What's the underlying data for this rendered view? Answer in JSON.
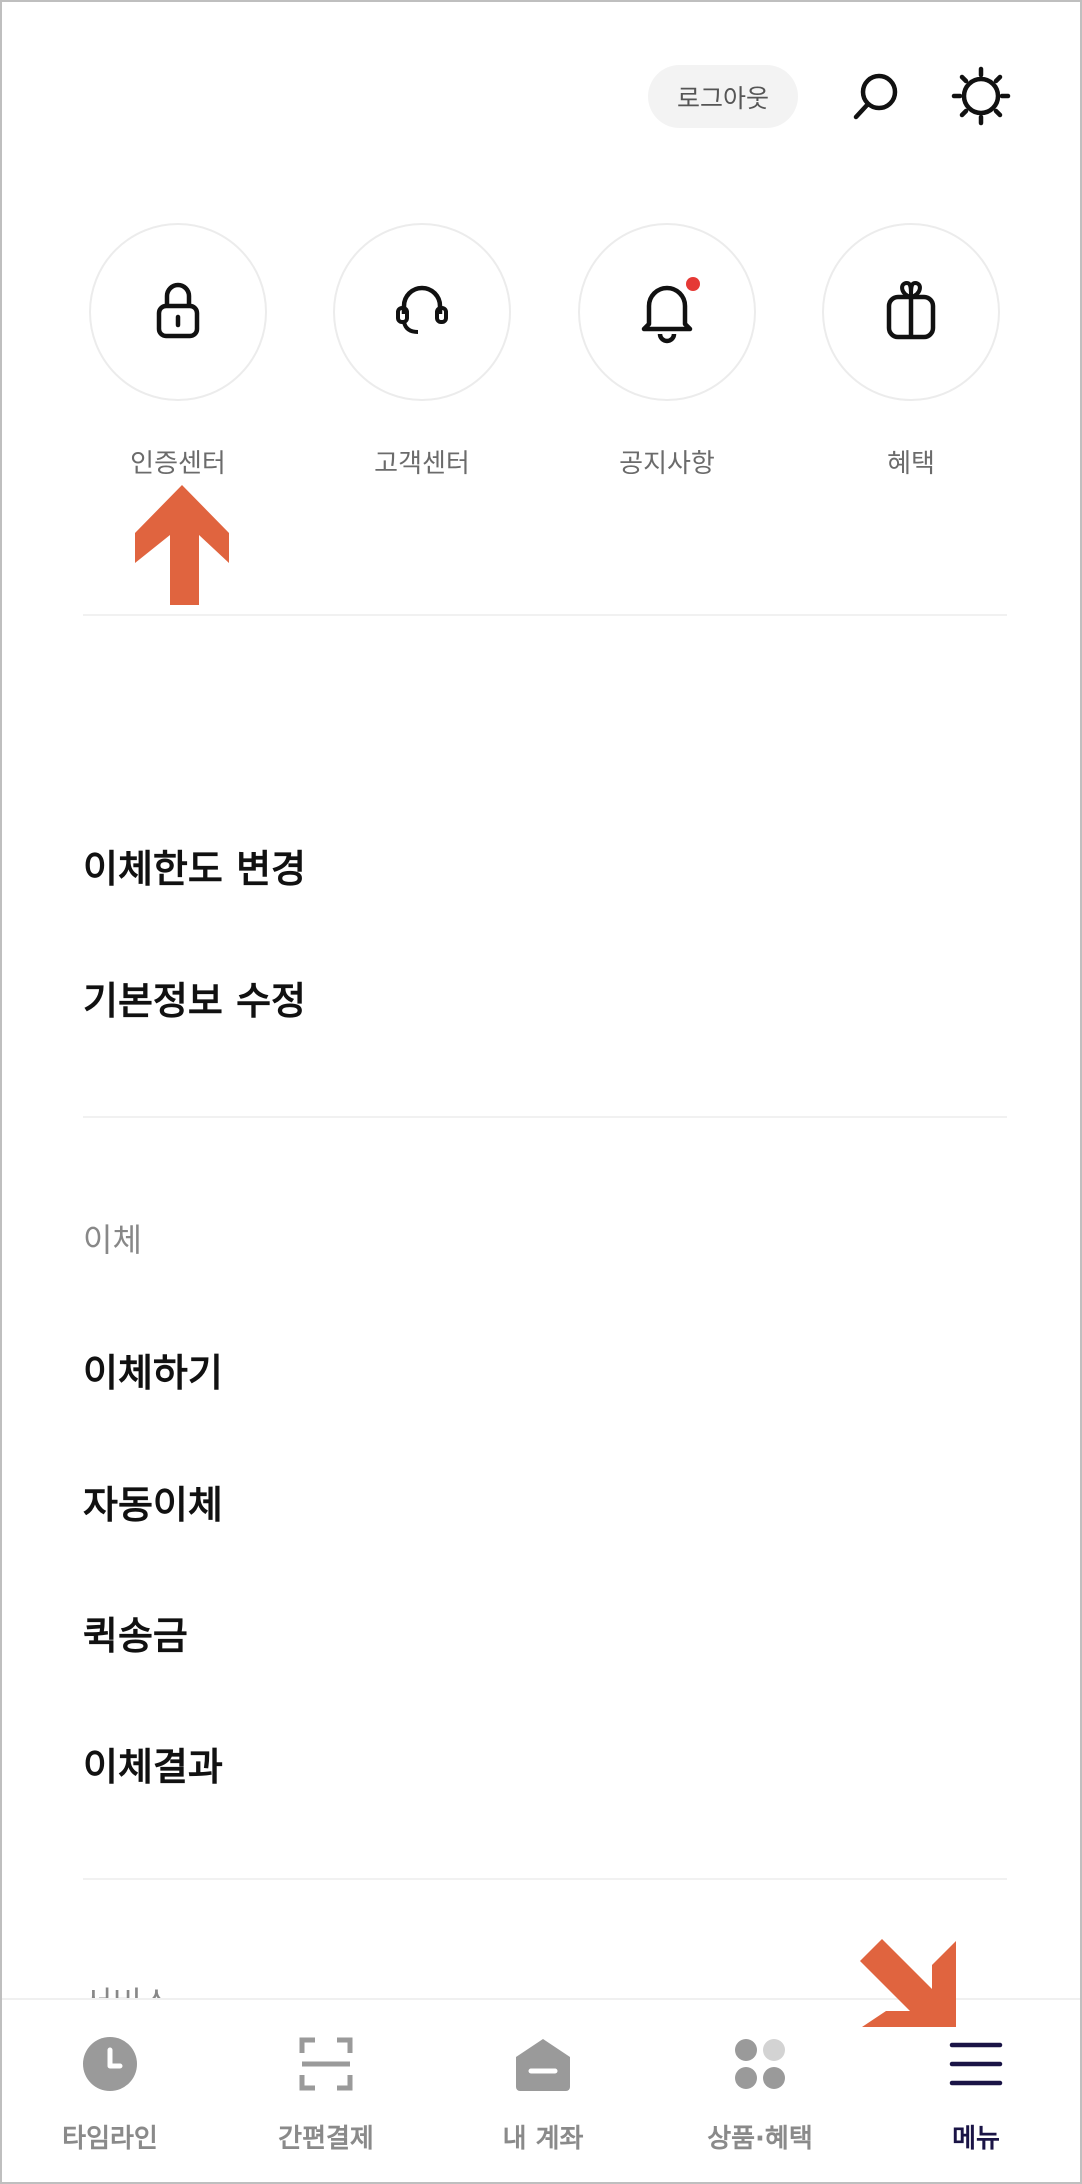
{
  "header": {
    "logout_label": "로그아웃",
    "search_icon": "search-icon",
    "settings_icon": "gear-icon"
  },
  "quick_menu": [
    {
      "label": "인증센터",
      "icon": "lock-icon"
    },
    {
      "label": "고객센터",
      "icon": "headset-icon"
    },
    {
      "label": "공지사항",
      "icon": "bell-icon",
      "badge": true
    },
    {
      "label": "혜택",
      "icon": "gift-icon"
    }
  ],
  "account_menu": [
    "이체한도 변경",
    "기본정보 수정"
  ],
  "transfer_section": {
    "title": "이체",
    "items": [
      "이체하기",
      "자동이체",
      "퀵송금",
      "이체결과"
    ]
  },
  "service_section": {
    "title": "서비스"
  },
  "bottom_nav": [
    {
      "label": "타임라인",
      "icon": "clock-icon"
    },
    {
      "label": "간편결제",
      "icon": "scan-icon"
    },
    {
      "label": "내 계좌",
      "icon": "wallet-icon"
    },
    {
      "label": "상품·혜택",
      "icon": "dots-grid-icon"
    },
    {
      "label": "메뉴",
      "icon": "hamburger-menu-icon",
      "active": true
    }
  ],
  "colors": {
    "accent_arrow": "#e0643f",
    "active_nav": "#1a1446",
    "badge": "#e53935"
  }
}
